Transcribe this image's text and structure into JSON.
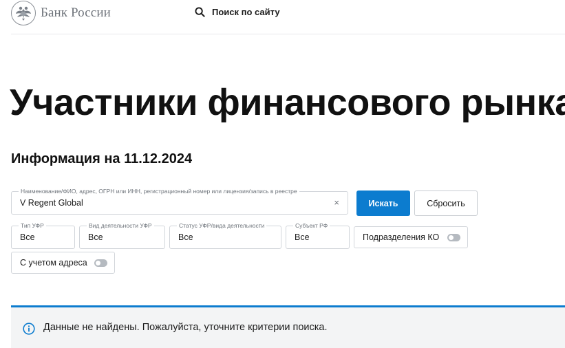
{
  "header": {
    "logo_text": "Банк России",
    "site_search_label": "Поиск по сайту"
  },
  "page": {
    "title": "Участники финансового рынка",
    "info_date": "Информация на 11.12.2024"
  },
  "search": {
    "query_label": "Наименование/ФИО, адрес, ОГРН или ИНН, регистрационный номер или лицензия/запись в реестре",
    "query_value": "V Regent Global",
    "clear_symbol": "×",
    "search_button": "Искать",
    "reset_button": "Сбросить"
  },
  "filters": [
    {
      "label": "Тип УФР",
      "value": "Все"
    },
    {
      "label": "Вид деятельности УФР",
      "value": "Все"
    },
    {
      "label": "Статус УФР/вида деятельности",
      "value": "Все"
    },
    {
      "label": "Субъект РФ",
      "value": "Все"
    }
  ],
  "toggles": [
    {
      "label": "Подразделения КО",
      "on": false
    },
    {
      "label": "С учетом адреса",
      "on": false
    }
  ],
  "notice": {
    "text": "Данные не найдены. Пожалуйста, уточните критерии поиска."
  },
  "icons": {
    "emblem": "double-headed-eagle-icon",
    "search": "search-icon",
    "info": "info-icon"
  },
  "colors": {
    "accent": "#0c7ccf",
    "notice_bg": "#f3f4f5",
    "border": "#d1d5da",
    "toggle_off": "#b5bac0"
  }
}
